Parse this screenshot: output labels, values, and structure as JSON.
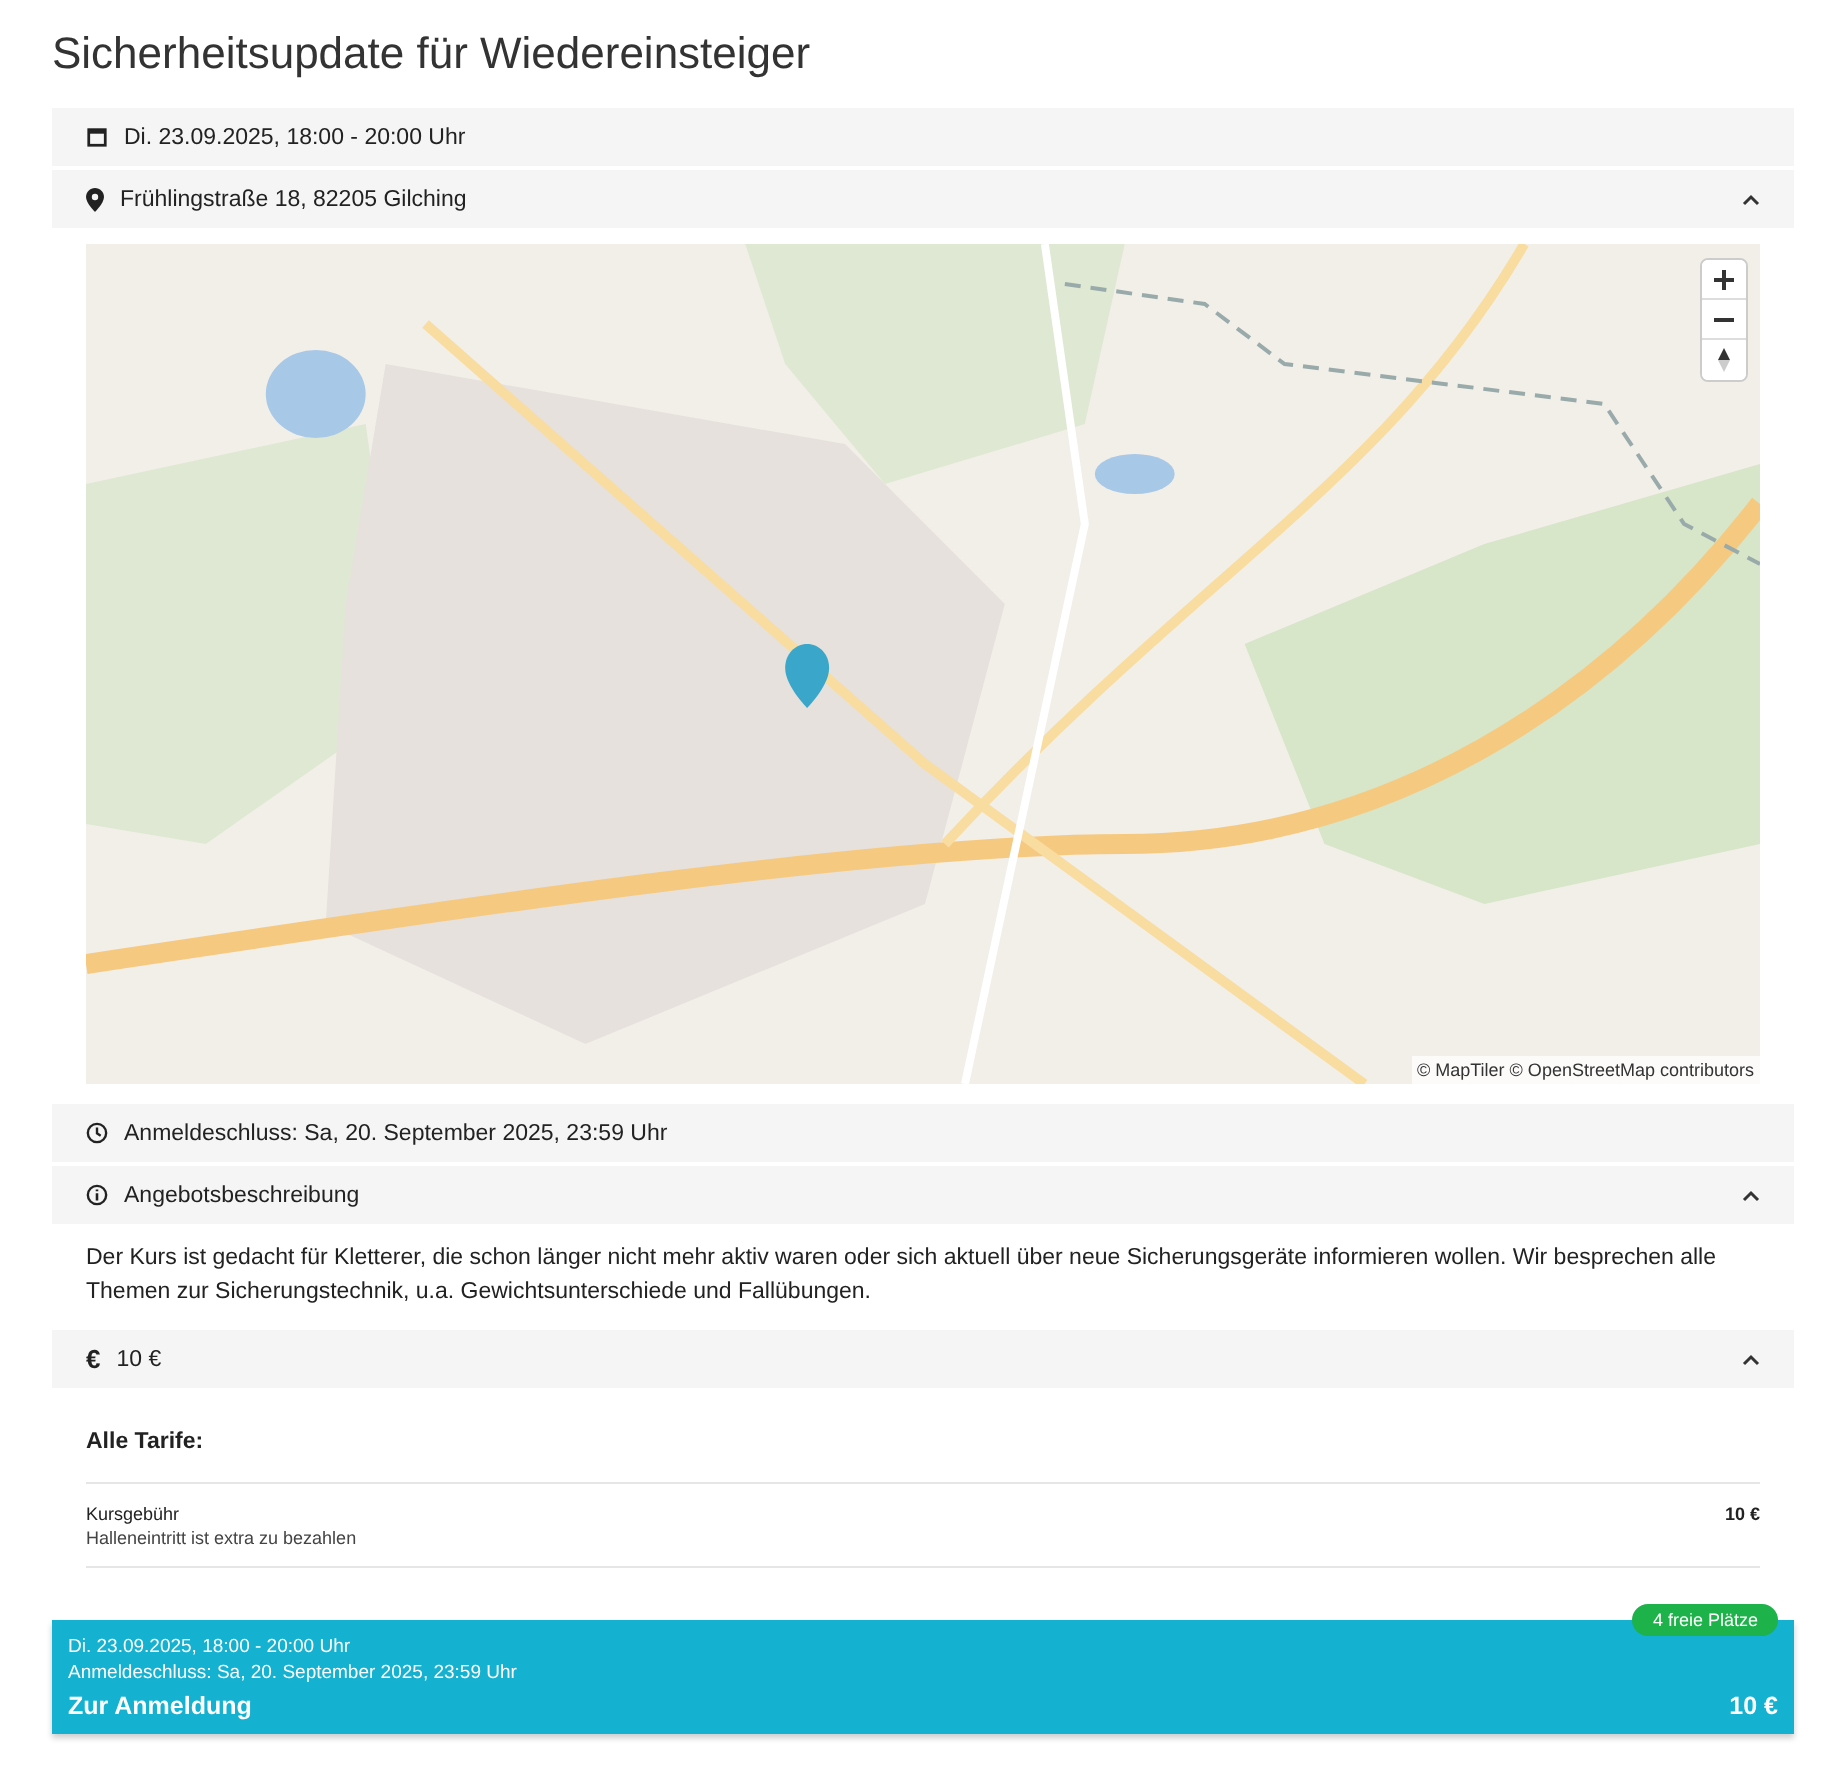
{
  "title": "Sicherheitsupdate für Wiedereinsteiger",
  "sections": [
    {
      "kind": "date",
      "label": "Di. 23.09.2025, 18:00 - 20:00 Uhr"
    },
    {
      "kind": "location",
      "label": "Frühlingstraße 18, 82205 Gilching",
      "expanded": true,
      "map": {
        "attribution": "© MapTiler © OpenStreetMap contributors"
      }
    },
    {
      "kind": "deadline",
      "label": "Anmeldeschluss: Sa, 20. September 2025, 23:59 Uhr"
    },
    {
      "kind": "description",
      "label": "Angebotsbeschreibung",
      "expanded": true,
      "text": "Der Kurs ist gedacht für Kletterer, die schon länger nicht mehr aktiv waren oder sich aktuell über neue Sicherungsgeräte informieren wollen. Wir besprechen alle Themen zur Sicherungstechnik, u.a. Gewichtsunterschiede und Fallübungen."
    },
    {
      "kind": "price",
      "icon_text": "€",
      "label": "10 €",
      "expanded": true,
      "tariffs": {
        "heading": "Alle Tarife:",
        "items": [
          {
            "name": "Kursgebühr",
            "note": "Halleneintritt ist extra zu bezahlen",
            "price": "10 €"
          }
        ]
      }
    }
  ],
  "booking": {
    "badge": "4 freie Plätze",
    "date": "Di. 23.09.2025, 18:00 - 20:00 Uhr",
    "deadline": "Anmeldeschluss: Sa, 20. September 2025, 23:59 Uhr",
    "action": "Zur Anmeldung",
    "price": "10 €"
  }
}
